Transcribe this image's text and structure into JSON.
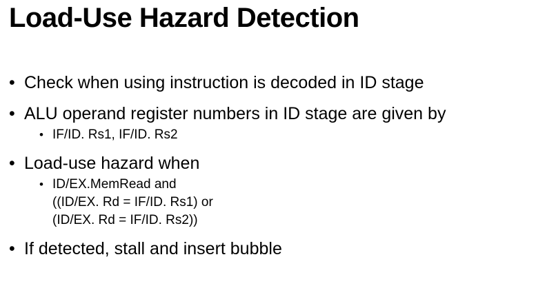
{
  "slide": {
    "title": "Load-Use Hazard Detection",
    "bullet_glyph": "•",
    "bullets": [
      {
        "text": "Check when using instruction is decoded in ID stage"
      },
      {
        "text": "ALU operand register numbers in ID stage are given by",
        "sub": [
          "IF/ID. Rs1, IF/ID. Rs2"
        ]
      },
      {
        "text": "Load-use hazard when",
        "sub_lines": [
          "ID/EX.MemRead and",
          "((ID/EX. Rd = IF/ID. Rs1) or",
          "(ID/EX. Rd = IF/ID. Rs2))"
        ]
      },
      {
        "text": "If detected, stall and insert bubble"
      }
    ]
  }
}
